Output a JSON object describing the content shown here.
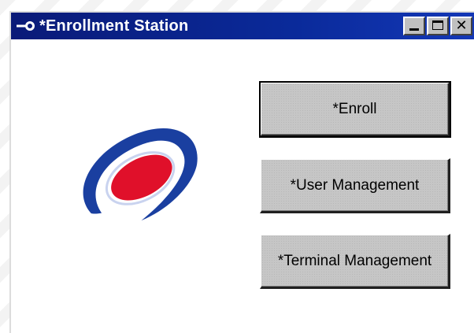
{
  "window": {
    "title": "*Enrollment Station",
    "title_icon": "key-icon",
    "controls": {
      "minimize": "minimize-icon",
      "maximize": "maximize-icon",
      "close": "close-icon"
    },
    "colors": {
      "titlebar": "#0a2a9a",
      "button_face": "#c6c6c6"
    }
  },
  "logo": {
    "icon": "eye-logo",
    "colors": {
      "ring": "#1a3fa0",
      "center": "#e0102a"
    }
  },
  "buttons": {
    "enroll_label": "*Enroll",
    "user_management_label": "*User Management",
    "terminal_management_label": "*Terminal Management"
  }
}
